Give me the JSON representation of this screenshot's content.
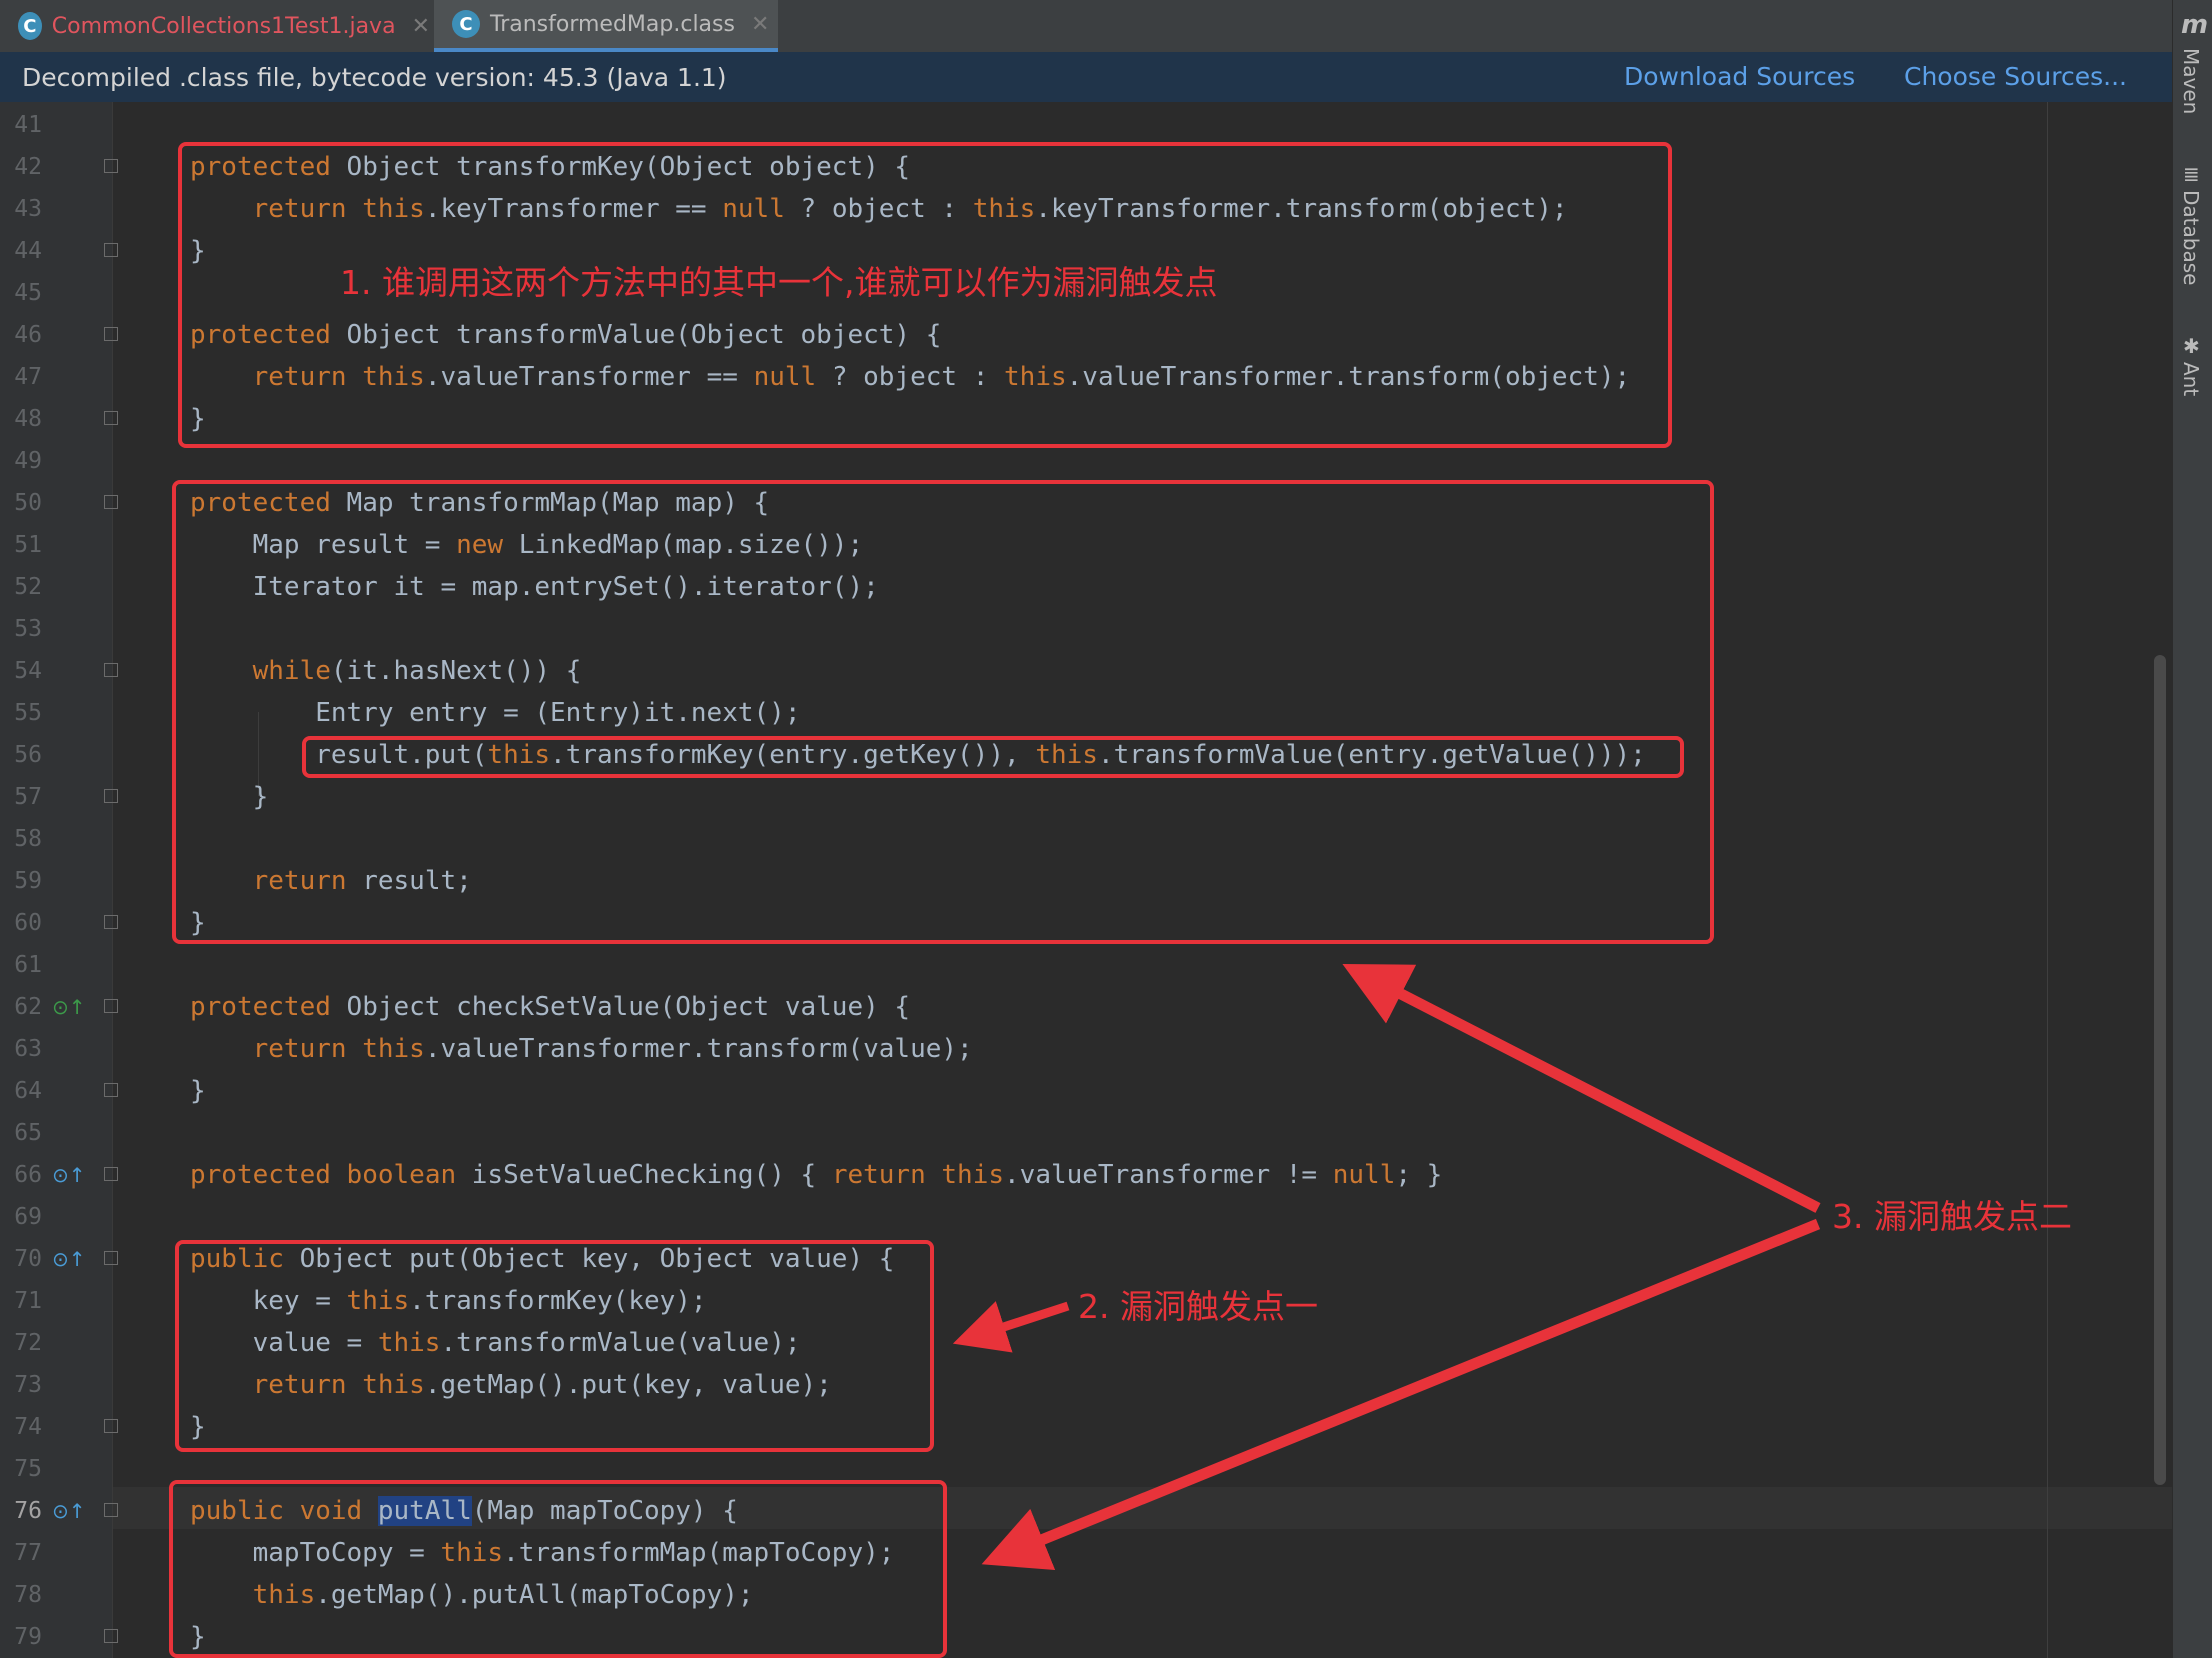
{
  "tabs": [
    {
      "label": "CommonCollections1Test1.java",
      "color": "#e0555e"
    },
    {
      "label": "TransformedMap.class",
      "color": "#bbbbbb"
    }
  ],
  "banner": {
    "text": "Decompiled .class file, bytecode version: 45.3 (Java 1.1)",
    "download_sources": "Download Sources",
    "choose_sources": "Choose Sources..."
  },
  "side_tools": [
    "Maven",
    "Database",
    "Ant"
  ],
  "lines": [
    {
      "n": "41",
      "code": ""
    },
    {
      "n": "42",
      "code": "protected Object transformKey(Object object) {"
    },
    {
      "n": "43",
      "code": "    return this.keyTransformer == null ? object : this.keyTransformer.transform(object);"
    },
    {
      "n": "44",
      "code": "}"
    },
    {
      "n": "45",
      "code": ""
    },
    {
      "n": "46",
      "code": "protected Object transformValue(Object object) {"
    },
    {
      "n": "47",
      "code": "    return this.valueTransformer == null ? object : this.valueTransformer.transform(object);"
    },
    {
      "n": "48",
      "code": "}"
    },
    {
      "n": "49",
      "code": ""
    },
    {
      "n": "50",
      "code": "protected Map transformMap(Map map) {"
    },
    {
      "n": "51",
      "code": "    Map result = new LinkedMap(map.size());"
    },
    {
      "n": "52",
      "code": "    Iterator it = map.entrySet().iterator();"
    },
    {
      "n": "53",
      "code": ""
    },
    {
      "n": "54",
      "code": "    while(it.hasNext()) {"
    },
    {
      "n": "55",
      "code": "        Entry entry = (Entry)it.next();"
    },
    {
      "n": "56",
      "code": "        result.put(this.transformKey(entry.getKey()), this.transformValue(entry.getValue()));"
    },
    {
      "n": "57",
      "code": "    }"
    },
    {
      "n": "58",
      "code": ""
    },
    {
      "n": "59",
      "code": "    return result;"
    },
    {
      "n": "60",
      "code": "}"
    },
    {
      "n": "61",
      "code": ""
    },
    {
      "n": "62",
      "code": "protected Object checkSetValue(Object value) {"
    },
    {
      "n": "63",
      "code": "    return this.valueTransformer.transform(value);"
    },
    {
      "n": "64",
      "code": "}"
    },
    {
      "n": "65",
      "code": ""
    },
    {
      "n": "66",
      "code": "protected boolean isSetValueChecking() { return this.valueTransformer != null; }"
    },
    {
      "n": "69",
      "code": ""
    },
    {
      "n": "70",
      "code": "public Object put(Object key, Object value) {"
    },
    {
      "n": "71",
      "code": "    key = this.transformKey(key);"
    },
    {
      "n": "72",
      "code": "    value = this.transformValue(value);"
    },
    {
      "n": "73",
      "code": "    return this.getMap().put(key, value);"
    },
    {
      "n": "74",
      "code": "}"
    },
    {
      "n": "75",
      "code": ""
    },
    {
      "n": "76",
      "code": "public void putAll(Map mapToCopy) {"
    },
    {
      "n": "77",
      "code": "    mapToCopy = this.transformMap(mapToCopy);"
    },
    {
      "n": "78",
      "code": "    this.getMap().putAll(mapToCopy);"
    },
    {
      "n": "79",
      "code": "}"
    }
  ],
  "annotations": {
    "a1": "1. 谁调用这两个方法中的其中一个,谁就可以作为漏洞触发点",
    "a2": "2. 漏洞触发点一",
    "a3": "3. 漏洞触发点二"
  },
  "colors": {
    "keyword": "#cc7832",
    "text": "#a9b7c6",
    "annotation": "#e8333a",
    "link": "#5ca0e8"
  }
}
